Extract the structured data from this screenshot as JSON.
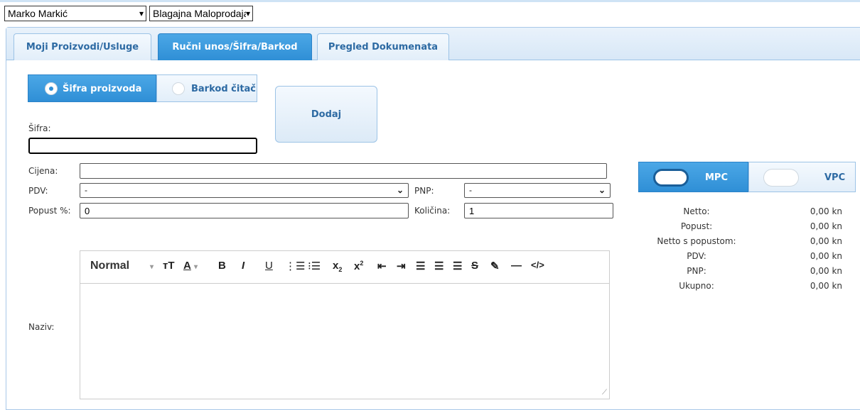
{
  "topbar": {
    "user_select": "Marko Markić",
    "register_select": "Blagajna Maloprodaja"
  },
  "tabs": [
    {
      "label": "Moji Proizvodi/Usluge",
      "active": false
    },
    {
      "label": "Ručni unos/Šifra/Barkod",
      "active": true
    },
    {
      "label": "Pregled Dokumenata",
      "active": false
    }
  ],
  "entry_mode": {
    "option1": "Šifra proizvoda",
    "option2": "Barkod čitač",
    "selected": "Šifra proizvoda"
  },
  "add_button": "Dodaj",
  "form": {
    "sifra_label": "Šifra:",
    "sifra_value": "",
    "cijena_label": "Cijena:",
    "cijena_value": "",
    "pdv_label": "PDV:",
    "pdv_value": "-",
    "pnp_label": "PNP:",
    "pnp_value": "-",
    "popust_label": "Popust %:",
    "popust_value": "0",
    "kolicina_label": "Količina:",
    "kolicina_value": "1",
    "naziv_label": "Naziv:"
  },
  "editor": {
    "format_select": "Normal",
    "tools": [
      "text-height-icon",
      "font-color-icon",
      "bold-icon",
      "italic-icon",
      "underline-icon",
      "ordered-list-icon",
      "bullet-list-icon",
      "subscript-icon",
      "superscript-icon",
      "outdent-icon",
      "indent-icon",
      "align-left-icon",
      "align-center-icon",
      "align-right-icon",
      "strikethrough-icon",
      "highlight-icon",
      "horizontal-rule-icon",
      "code-icon"
    ]
  },
  "price_mode": {
    "option1": "MPC",
    "option2": "VPC",
    "selected": "MPC"
  },
  "summary": [
    {
      "label": "Netto:",
      "value": "0,00 kn"
    },
    {
      "label": "Popust:",
      "value": "0,00 kn"
    },
    {
      "label": "Netto s popustom:",
      "value": "0,00 kn"
    },
    {
      "label": "PDV:",
      "value": "0,00 kn"
    },
    {
      "label": "PNP:",
      "value": "0,00 kn"
    },
    {
      "label": "Ukupno:",
      "value": "0,00 kn"
    }
  ],
  "colors": {
    "accent": "#2f8fd6",
    "tab_text": "#2d6aa3",
    "border": "#9cc3e6"
  }
}
